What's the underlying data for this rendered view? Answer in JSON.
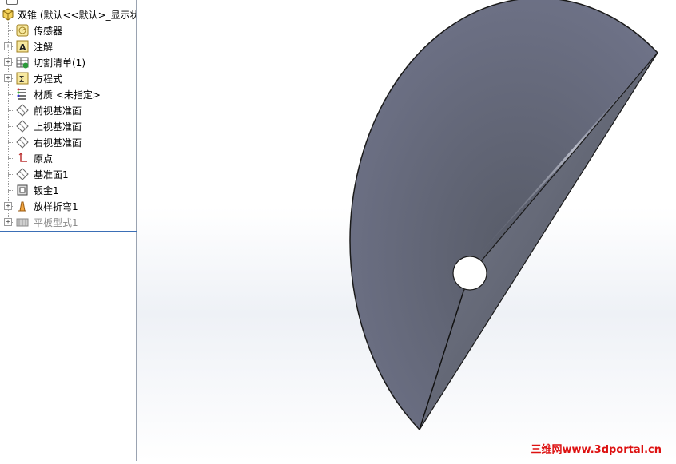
{
  "feature_tree": {
    "root": {
      "label": "双锥  (默认<<默认>_显示状",
      "icon": "part-icon"
    },
    "items": [
      {
        "label": "传感器",
        "icon": "sensor-icon",
        "expandable": false,
        "dimmed": false
      },
      {
        "label": "注解",
        "icon": "annotation-icon",
        "expandable": true,
        "dimmed": false
      },
      {
        "label": "切割清单(1)",
        "icon": "cutlist-icon",
        "expandable": true,
        "dimmed": false
      },
      {
        "label": "方程式",
        "icon": "equation-icon",
        "expandable": true,
        "dimmed": false
      },
      {
        "label": "材质 <未指定>",
        "icon": "material-icon",
        "expandable": false,
        "dimmed": false
      },
      {
        "label": "前视基准面",
        "icon": "plane-icon",
        "expandable": false,
        "dimmed": false
      },
      {
        "label": "上视基准面",
        "icon": "plane-icon",
        "expandable": false,
        "dimmed": false
      },
      {
        "label": "右视基准面",
        "icon": "plane-icon",
        "expandable": false,
        "dimmed": false
      },
      {
        "label": "原点",
        "icon": "origin-icon",
        "expandable": false,
        "dimmed": false
      },
      {
        "label": "基准面1",
        "icon": "plane-icon",
        "expandable": false,
        "dimmed": false
      },
      {
        "label": "钣金1",
        "icon": "sheetmetal-icon",
        "expandable": false,
        "dimmed": false
      },
      {
        "label": "放样折弯1",
        "icon": "lofted-bend-icon",
        "expandable": true,
        "dimmed": false
      },
      {
        "label": "平板型式1",
        "icon": "flat-pattern-icon",
        "expandable": true,
        "dimmed": true
      }
    ]
  },
  "viewport": {
    "model": "half-cone sheet metal part",
    "colors": {
      "body_dark": "#4b4f5b",
      "body_light": "#a9adbb",
      "edge": "#1a1a1a",
      "hole": "#ffffff"
    }
  },
  "watermark": "三维网www.3dportal.cn",
  "colors": {
    "accent": "#3b6fb6",
    "watermark": "#dd1111"
  }
}
